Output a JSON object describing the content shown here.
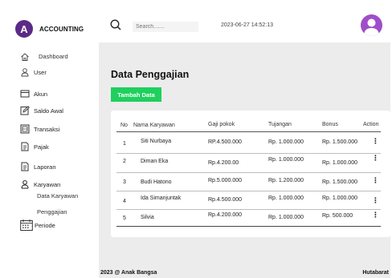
{
  "app": {
    "brand_initial": "A",
    "brand_name": "ACCOUNTING"
  },
  "colors": {
    "brand": "#5b2a86",
    "accent_button": "#1fd05d",
    "avatar": "#a04dc9",
    "background": "#ececec"
  },
  "sidebar": {
    "items": [
      {
        "label": "Dashboard",
        "icon": "home-icon"
      },
      {
        "label": "User",
        "icon": "user-icon"
      },
      {
        "label": "Akun",
        "icon": "card-icon"
      },
      {
        "label": "Saldo Awal",
        "icon": "edit-icon"
      },
      {
        "label": "Transaksi",
        "icon": "transaction-icon"
      },
      {
        "label": "Pajak",
        "icon": "document-icon"
      },
      {
        "label": "Laporan",
        "icon": "report-icon"
      },
      {
        "label": "Karyawan",
        "icon": "user-icon"
      },
      {
        "label": "Periode",
        "icon": "calendar-icon"
      }
    ],
    "sub_items": [
      "Data Karyawan",
      "Penggajian"
    ]
  },
  "topbar": {
    "search_placeholder": "Search.......",
    "datetime": "2023-06-27 14:52:13"
  },
  "main": {
    "title": "Data Penggajian",
    "add_button_label": "Tambah Data",
    "table": {
      "headers": [
        "No",
        "Nama Karyawan",
        "Gaji pokok",
        "Tujangan",
        "Bonus",
        "Action"
      ],
      "rows": [
        {
          "no": "1",
          "name": "Siti Nurbaya",
          "salary": "RP.4.500.000",
          "allowance": "Rp. 1.000.000",
          "bonus": "Rp. 1.500.000"
        },
        {
          "no": "2",
          "name": "Diman Eka",
          "salary": "Rp.4.200.00",
          "allowance": "Rp. 1.000.000",
          "bonus": "Rp. 1.000.000"
        },
        {
          "no": "3",
          "name": "Budi Hatono",
          "salary": "Rp.5.000.000",
          "allowance": "Rp. 1.200.000",
          "bonus": "Rp. 1.500.000"
        },
        {
          "no": "4",
          "name": "Ida Simanjuntak",
          "salary": "Rp.4.500.000",
          "allowance": "Rp. 1.000.000",
          "bonus": "Rp. 1.000.000"
        },
        {
          "no": "5",
          "name": "Silvia",
          "salary": "Rp.4.200.000",
          "allowance": "Rp. 1.000.000",
          "bonus": "Rp. 500.000"
        }
      ],
      "action_icon": "kebab-menu-icon"
    }
  },
  "footer": {
    "left": "2023 @ Anak Bangsa",
    "right": "Hutabarat"
  }
}
